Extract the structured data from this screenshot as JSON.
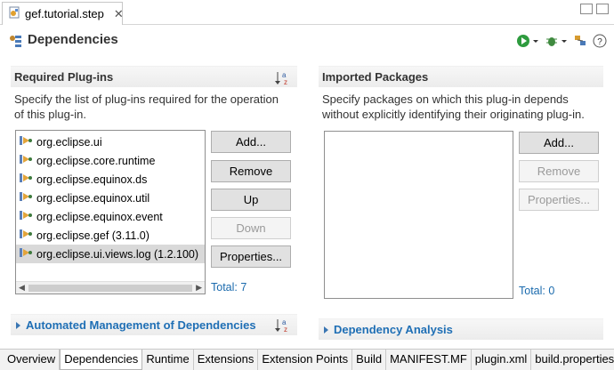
{
  "editor_tab": {
    "title": "gef.tutorial.step",
    "close": "✕"
  },
  "header": {
    "title": "Dependencies"
  },
  "required_plugins": {
    "title": "Required Plug-ins",
    "description_line1": "Specify the list of plug-ins required for the operation",
    "description_line2": "of this plug-in.",
    "items": [
      "org.eclipse.ui",
      "org.eclipse.core.runtime",
      "org.eclipse.equinox.ds",
      "org.eclipse.equinox.util",
      "org.eclipse.equinox.event",
      "org.eclipse.gef (3.11.0)",
      "org.eclipse.ui.views.log (1.2.100)"
    ],
    "buttons": {
      "add": "Add...",
      "remove": "Remove",
      "up": "Up",
      "down": "Down",
      "properties": "Properties..."
    },
    "total": "Total: 7"
  },
  "imported_packages": {
    "title": "Imported Packages",
    "description_line1": "Specify packages on which this plug-in depends",
    "description_line2": "without explicitly identifying their originating plug-in.",
    "buttons": {
      "add": "Add...",
      "remove": "Remove",
      "properties": "Properties..."
    },
    "total": "Total: 0"
  },
  "automated_management": {
    "title": "Automated Management of Dependencies"
  },
  "dependency_analysis": {
    "title": "Dependency Analysis"
  },
  "bottom_tabs": [
    "Overview",
    "Dependencies",
    "Runtime",
    "Extensions",
    "Extension Points",
    "Build",
    "MANIFEST.MF",
    "plugin.xml",
    "build.properties"
  ],
  "colors": {
    "link": "#1f6fb5",
    "total": "#1a6aad",
    "selected_row": "#d9d9d9"
  },
  "icons": [
    "plugin-file-icon",
    "dependencies-icon",
    "run-icon",
    "debug-icon",
    "export-icon",
    "help-icon",
    "sort-az-icon",
    "plugin-icon"
  ]
}
